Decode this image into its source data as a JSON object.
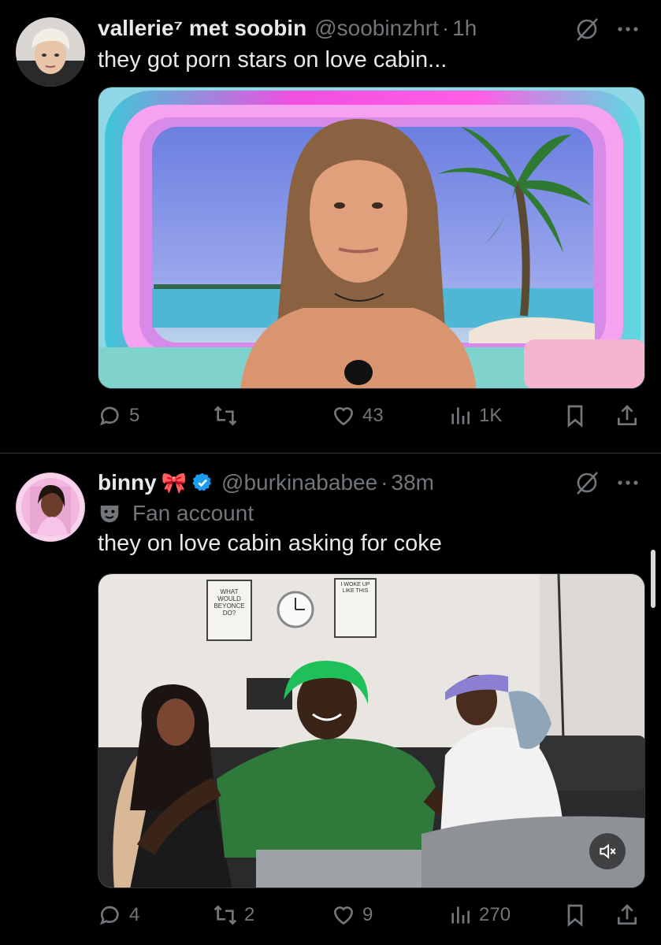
{
  "tweets": [
    {
      "name": "vallerie⁷ met soobin",
      "handle": "@soobinzhrt",
      "separator": "·",
      "time": "1h",
      "text": "they got porn stars on love cabin...",
      "media_type": "image",
      "stats": {
        "replies": "5",
        "reposts": "",
        "likes": "43",
        "views": "1K"
      }
    },
    {
      "name": "binny",
      "ribbon": "🎀",
      "verified": true,
      "handle": "@burkinababee",
      "separator": "·",
      "time": "38m",
      "label": "Fan account",
      "text": "they on love cabin asking for coke",
      "media_type": "video",
      "poster_left": "WHAT WOULD BEYONCE DO?",
      "poster_right": "I WOKE UP LIKE THIS",
      "stats": {
        "replies": "4",
        "reposts": "2",
        "likes": "9",
        "views": "270"
      }
    }
  ],
  "colors": {
    "background": "#000000",
    "text_primary": "#e7e9ea",
    "text_secondary": "#71767b",
    "divider": "#2f3336",
    "verified_blue": "#1d9bf0"
  },
  "icons": [
    "grok-icon",
    "more-icon",
    "reply-icon",
    "repost-icon",
    "like-icon",
    "views-icon",
    "bookmark-icon",
    "share-icon",
    "mute-icon",
    "verified-icon",
    "fan-mask-icon"
  ]
}
